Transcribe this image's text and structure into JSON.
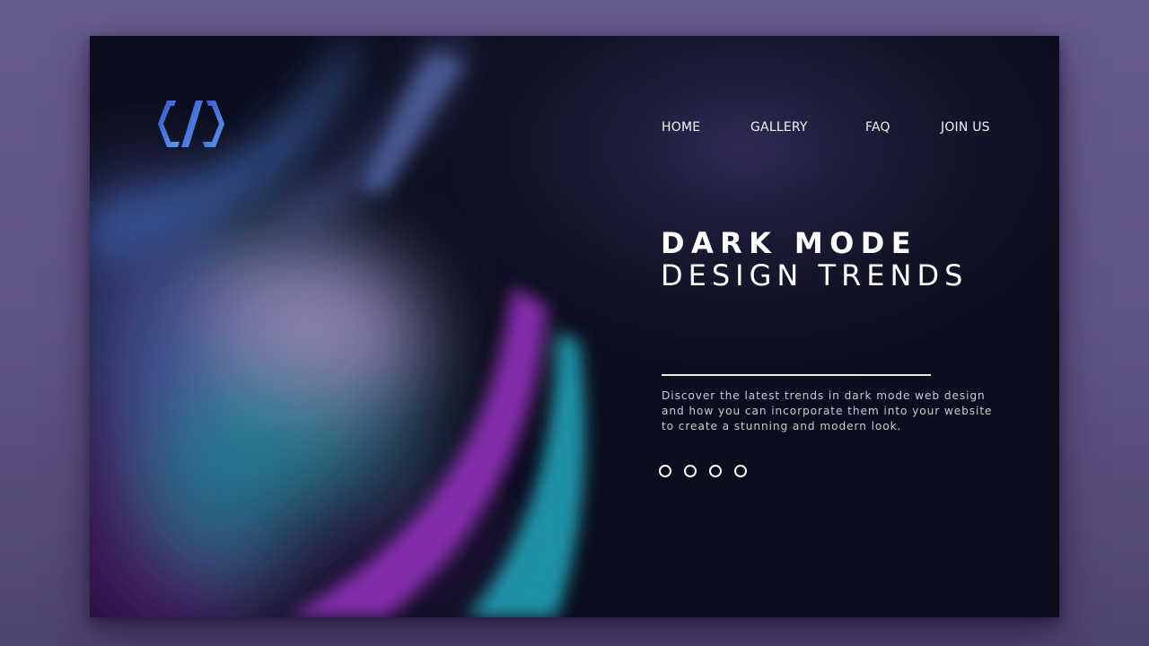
{
  "logo": {
    "icon": "code-hexagon-icon",
    "colors": [
      "#3a52c8",
      "#4a7de0",
      "#5b9cf0"
    ]
  },
  "nav": {
    "items": [
      {
        "label": "HOME"
      },
      {
        "label": "GALLERY"
      },
      {
        "label": "FAQ"
      },
      {
        "label": "JOIN US"
      }
    ]
  },
  "hero": {
    "title_line1": "DARK MODE",
    "title_line2": "DESIGN TRENDS",
    "description_lines": [
      "Discover the latest trends in dark mode web design",
      "and how you can incorporate them into your website",
      "to create a stunning and modern look."
    ]
  },
  "carousel": {
    "dot_count": 4
  },
  "colors": {
    "page_background": "#665b8e",
    "panel_background": "#0e1020",
    "text": "#ffffff",
    "accent_teal": "#2fc3d6",
    "accent_magenta": "#b13ad6",
    "accent_blue": "#4a7de0"
  }
}
